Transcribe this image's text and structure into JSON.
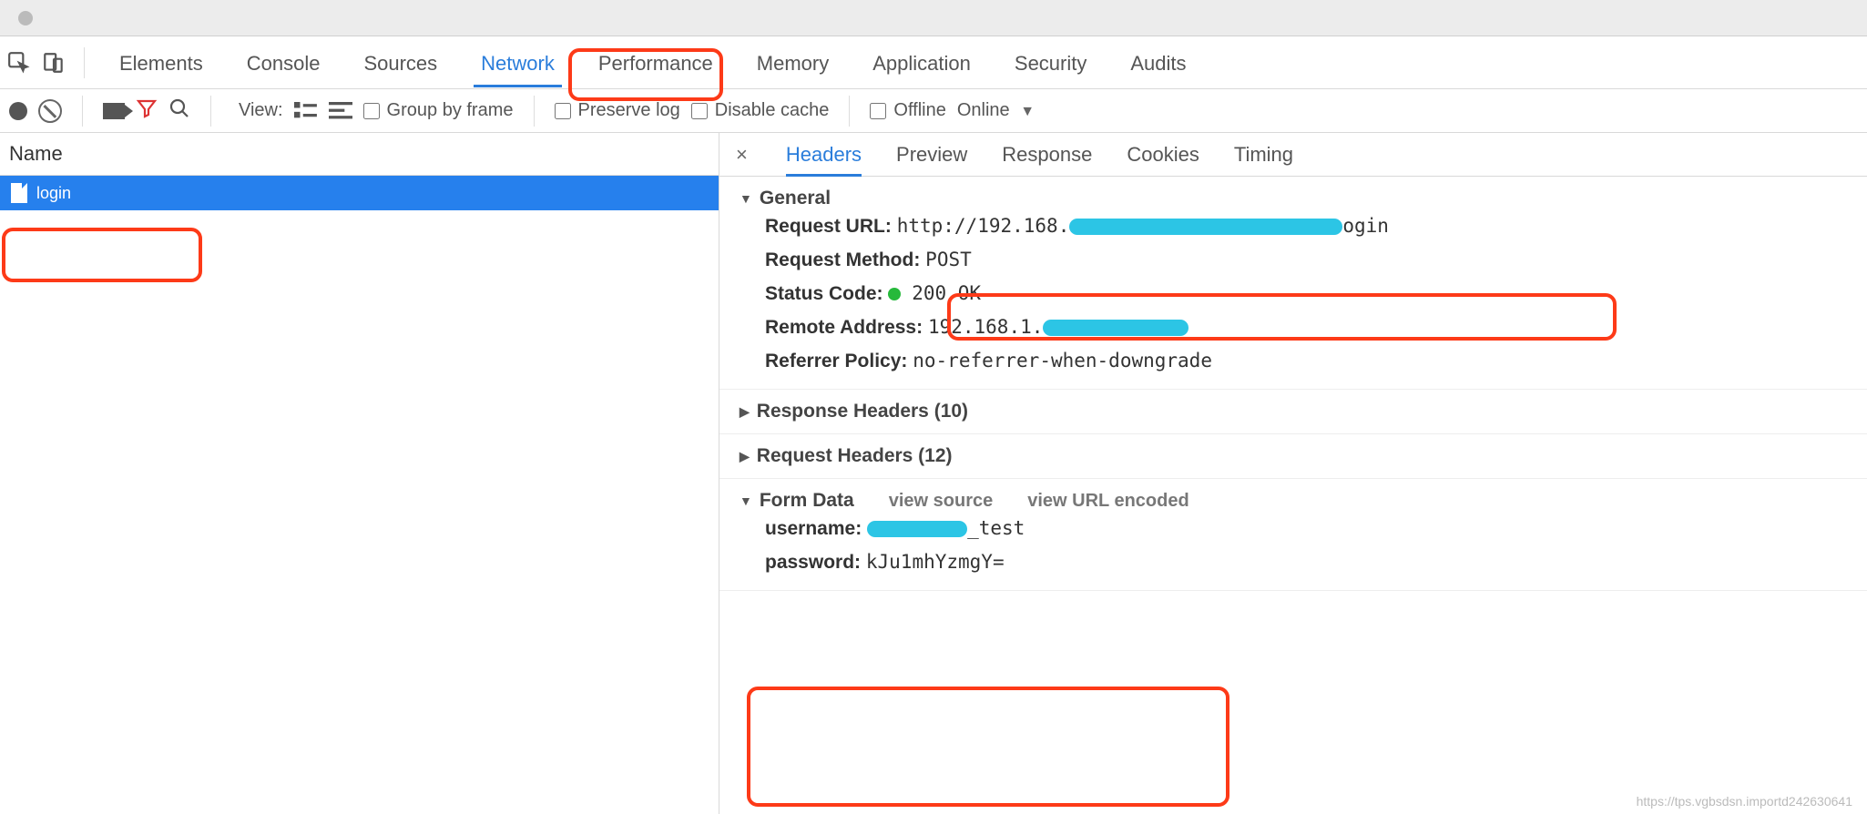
{
  "tabs": {
    "elements": "Elements",
    "console": "Console",
    "sources": "Sources",
    "network": "Network",
    "performance": "Performance",
    "memory": "Memory",
    "application": "Application",
    "security": "Security",
    "audits": "Audits"
  },
  "toolbar": {
    "view_label": "View:",
    "group_by_frame": "Group by frame",
    "preserve_log": "Preserve log",
    "disable_cache": "Disable cache",
    "offline": "Offline",
    "online": "Online"
  },
  "leftpane": {
    "name_header": "Name",
    "requests": [
      {
        "name": "login"
      }
    ]
  },
  "detail_tabs": {
    "headers": "Headers",
    "preview": "Preview",
    "response": "Response",
    "cookies": "Cookies",
    "timing": "Timing"
  },
  "general": {
    "section_title": "General",
    "request_url_label": "Request URL:",
    "request_url_prefix": "http://192.168.",
    "request_url_suffix": "ogin",
    "request_method_label": "Request Method:",
    "request_method_value": "POST",
    "status_code_label": "Status Code:",
    "status_code_value": "200 OK",
    "remote_address_label": "Remote Address:",
    "remote_address_prefix": "192.168.1.",
    "referrer_policy_label": "Referrer Policy:",
    "referrer_policy_value": "no-referrer-when-downgrade"
  },
  "response_headers": {
    "title": "Response Headers (10)"
  },
  "request_headers": {
    "title": "Request Headers (12)"
  },
  "form_data": {
    "title": "Form Data",
    "view_source": "view source",
    "view_url_encoded": "view URL encoded",
    "username_label": "username:",
    "username_suffix": "_test",
    "password_label": "password:",
    "password_value": "kJu1mhYzmgY="
  },
  "watermark": "https://tps.vgbsdsn.importd242630641"
}
